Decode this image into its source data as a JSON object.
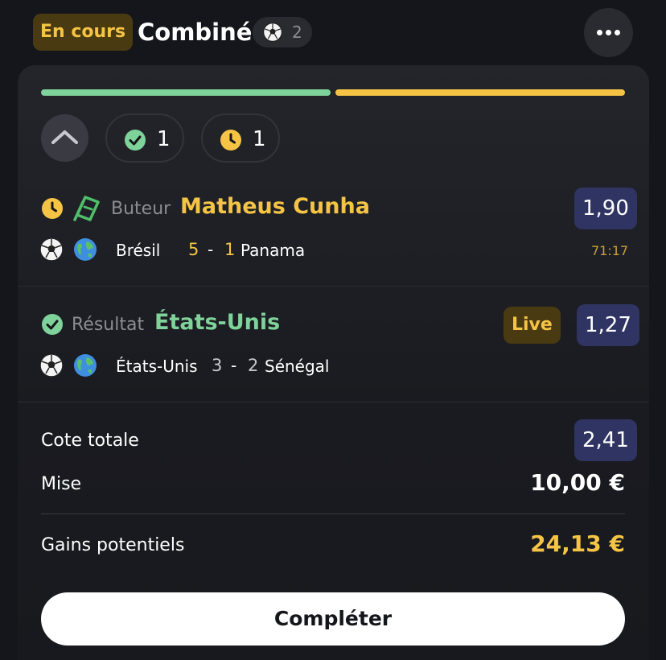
{
  "header": {
    "status": "En cours",
    "title": "Combiné",
    "sport_count": "2"
  },
  "summary_chips": {
    "won_count": "1",
    "pending_count": "1"
  },
  "progress": {
    "won_fraction": 0.5,
    "pending_fraction": 0.5
  },
  "selections": [
    {
      "state": "pending",
      "market": "Buteur",
      "pick": "Matheus Cunha",
      "odds": "1,90",
      "home": "Brésil",
      "home_score": "5",
      "away_score": "1",
      "away": "Panama",
      "clock": "71:17"
    },
    {
      "state": "won",
      "market": "Résultat",
      "pick": "États-Unis",
      "live_label": "Live",
      "odds": "1,27",
      "home": "États-Unis",
      "home_score": "3",
      "away_score": "2",
      "away": "Sénégal"
    }
  ],
  "totals": {
    "total_odds_label": "Cote totale",
    "total_odds": "2,41",
    "stake_label": "Mise",
    "stake": "10,00 €",
    "gains_label": "Gains potentiels",
    "gains": "24,13 €"
  },
  "actions": {
    "complete_label": "Compléter"
  },
  "colors": {
    "background": "#15161b",
    "won_green": "#7fd29a",
    "pending_yellow": "#f5c445",
    "odds_badge": "#2f3463"
  },
  "icons": {
    "status": [
      "check-circle-icon",
      "clock-icon"
    ],
    "boost": "boost-ticket-icon",
    "sport": "soccer-ball-icon",
    "competition": "globe-icon",
    "more": "ellipsis-icon",
    "collapse": "chevron-up-icon"
  }
}
